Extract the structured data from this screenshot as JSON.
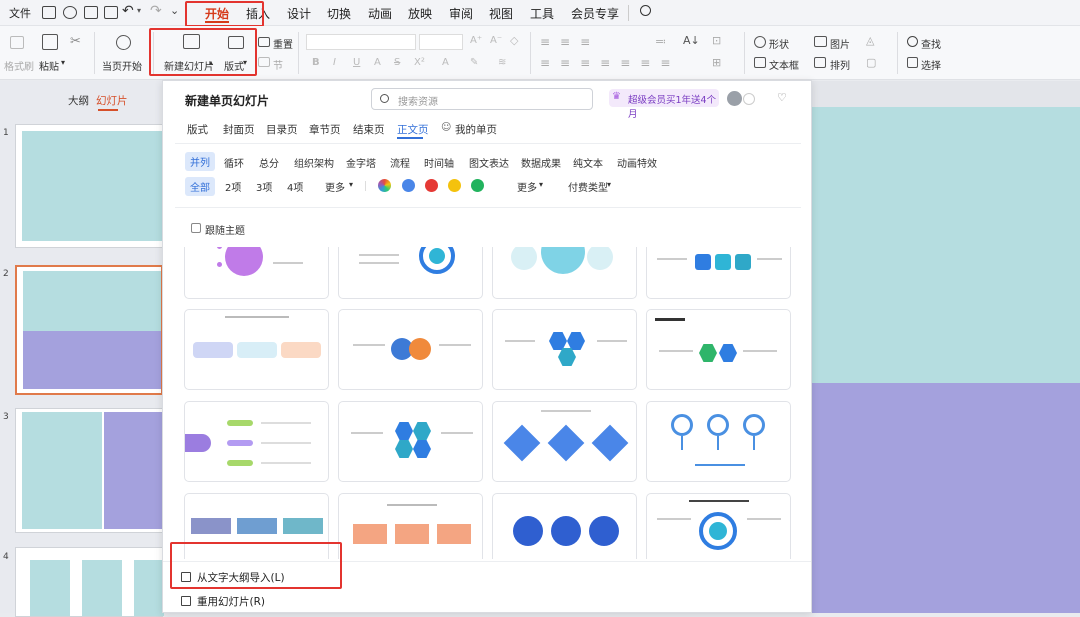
{
  "menu": {
    "file": "文件",
    "tabs": [
      "开始",
      "插入",
      "设计",
      "切换",
      "动画",
      "放映",
      "审阅",
      "视图",
      "工具",
      "会员专享"
    ]
  },
  "ribbon": {
    "format_painter": "格式刷",
    "paste": "粘贴",
    "from_current": "当页开始",
    "new_slide": "新建幻灯片",
    "layout": "版式",
    "reset": "重置",
    "section": "节",
    "shape": "形状",
    "picture": "图片",
    "textbox": "文本框",
    "arrange": "排列",
    "find": "查找",
    "select": "选择"
  },
  "left_tabs": {
    "outline": "大纲",
    "slides": "幻灯片"
  },
  "slide_numbers": [
    "1",
    "2",
    "3",
    "4"
  ],
  "popup": {
    "title": "新建单页幻灯片",
    "search_placeholder": "搜索资源",
    "promo": "超级会员买1年送4个月",
    "tabs": [
      "版式",
      "封面页",
      "目录页",
      "章节页",
      "结束页",
      "正文页",
      "我的单页"
    ],
    "categories": [
      "并列",
      "循环",
      "总分",
      "组织架构",
      "金字塔",
      "流程",
      "时间轴",
      "图文表达",
      "数据成果",
      "纯文本",
      "动画特效"
    ],
    "filters": [
      "全部",
      "2项",
      "3项",
      "4项",
      "更多"
    ],
    "more": "更多",
    "pay_type": "付费类型",
    "follow_theme": "跟随主题",
    "import_outline": "从文字大纲导入(L)",
    "reuse_slides": "重用幻灯片(R)"
  },
  "colors": {
    "accent": "#3370d8",
    "highlight_box": "#e3342f",
    "slide_teal": "#b5dde0",
    "slide_purple": "#a4a1dd"
  }
}
